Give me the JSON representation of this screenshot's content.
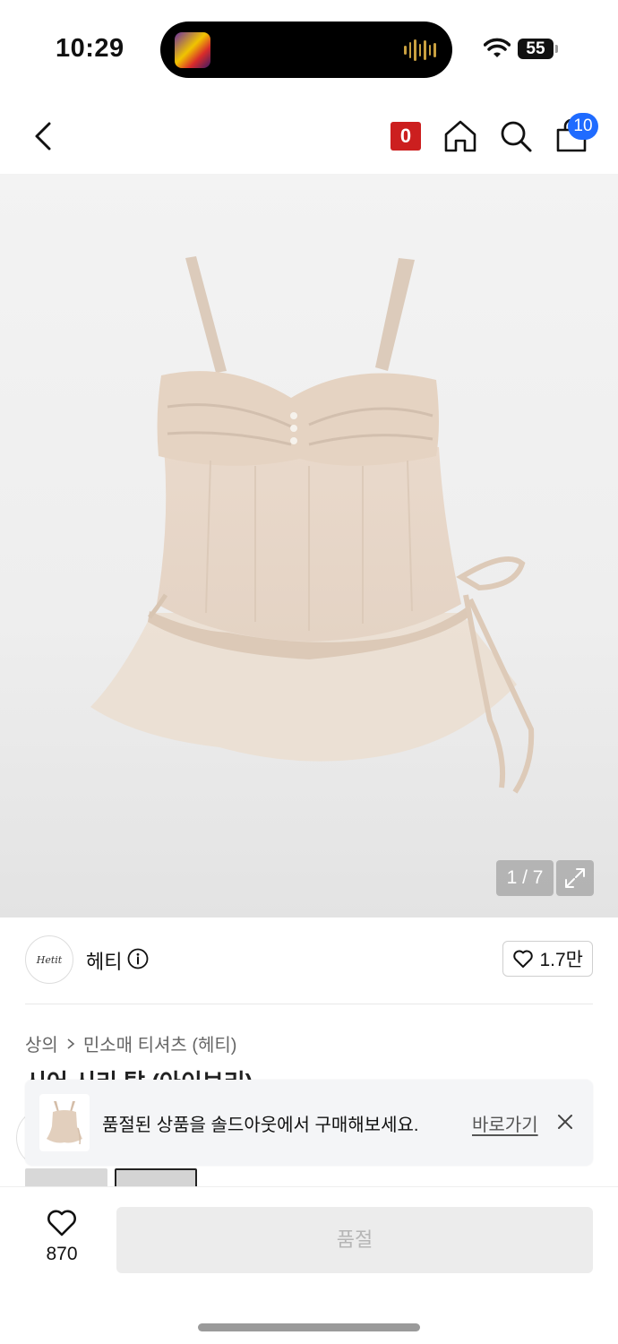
{
  "status": {
    "time": "10:29",
    "battery": "55"
  },
  "header": {
    "points_badge": "0",
    "cart_count": "10"
  },
  "gallery": {
    "counter": "1 / 7"
  },
  "brand": {
    "logo_text": "Hetit",
    "name": "헤티",
    "likes": "1.7만"
  },
  "breadcrumb": {
    "category": "상의",
    "subcategory": "민소매 티셔츠 (헤티)"
  },
  "product": {
    "title": "시어 시리 탑 (아이보리)"
  },
  "toast": {
    "message": "품절된 상품을 솔드아웃에서 구매해보세요.",
    "link": "바로가기"
  },
  "bottom_bar": {
    "wish_count": "870",
    "action_label": "품절"
  },
  "colors": {
    "accent_blue": "#1f6bff",
    "points_red": "#cc1f1f",
    "garment": "#e8d9cb"
  },
  "icons": [
    "back-arrow-icon",
    "home-icon",
    "search-icon",
    "shopping-bag-icon",
    "expand-icon",
    "info-icon",
    "heart-icon",
    "close-icon"
  ]
}
